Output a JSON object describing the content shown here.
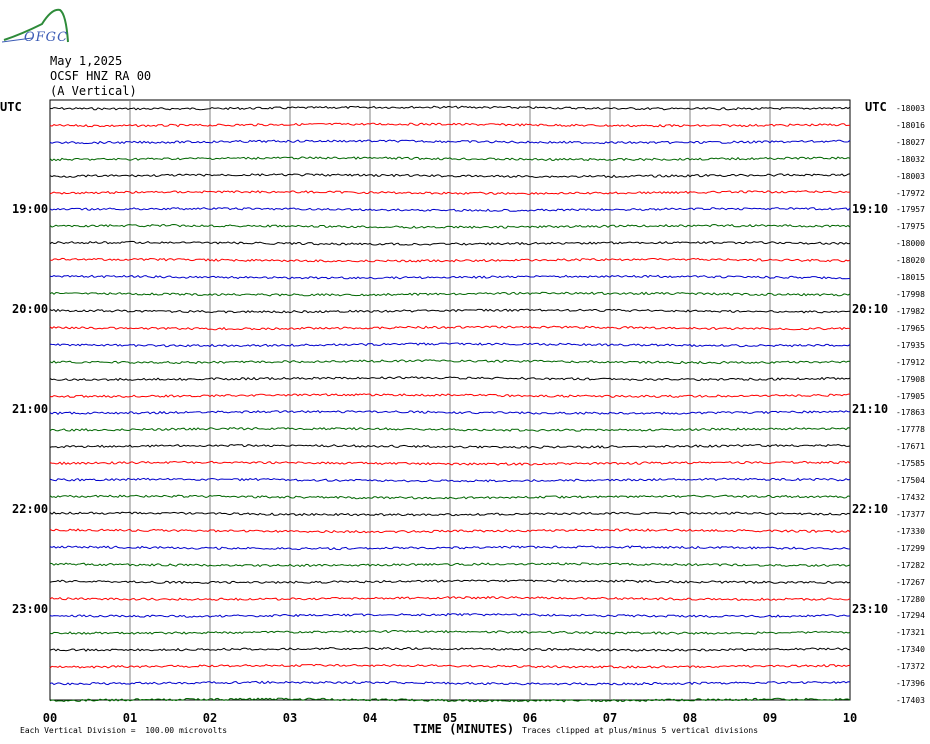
{
  "logo": {
    "text": "OFGC"
  },
  "header": {
    "date": "May 1,2025",
    "station": "OCSF HNZ RA 00",
    "component": "(A Vertical)"
  },
  "left_axis": {
    "title": "UTC",
    "hour_labels": [
      "19:00",
      "20:00",
      "21:00",
      "22:00",
      "23:00"
    ]
  },
  "right_axis": {
    "title": "UTC",
    "hour_labels": [
      "19:10",
      "20:10",
      "21:10",
      "22:10",
      "23:10"
    ]
  },
  "footer": {
    "scale_note": "Each Vertical Division =  100.00 microvolts",
    "x_title": "TIME (MINUTES)",
    "clip_note": "Traces clipped at plus/minus 5 vertical divisions"
  },
  "colors": {
    "black": "#000000",
    "red": "#ff0000",
    "blue": "#0000cc",
    "green": "#006600",
    "grid": "#808080"
  },
  "chart_data": {
    "type": "line",
    "x_ticks": [
      "00",
      "01",
      "02",
      "03",
      "04",
      "05",
      "06",
      "07",
      "08",
      "09",
      "10"
    ],
    "xlim": [
      0,
      10
    ],
    "trace_color_cycle": [
      "black",
      "red",
      "blue",
      "green"
    ],
    "trace_offsets": [
      -18003,
      -18016,
      -18027,
      -18032,
      -18003,
      -17972,
      -17957,
      -17975,
      -18000,
      -18020,
      -18015,
      -17998,
      -17982,
      -17965,
      -17935,
      -17912,
      -17908,
      -17905,
      -17863,
      -17778,
      -17671,
      -17585,
      -17504,
      -17432,
      -17377,
      -17330,
      -17299,
      -17282,
      -17267,
      -17280,
      -17294,
      -17321,
      -17340,
      -17372,
      -17396,
      -17403
    ],
    "grid": true
  }
}
